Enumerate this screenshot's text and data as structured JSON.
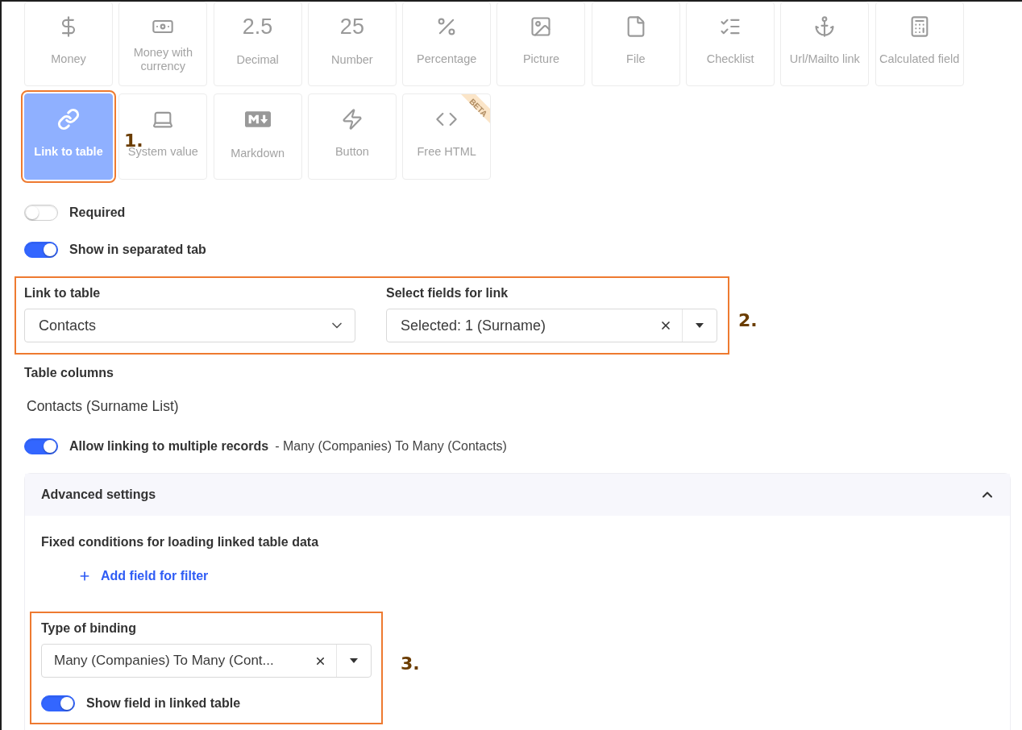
{
  "field_types": [
    {
      "label": "Money",
      "kind": "dollar",
      "selected": false,
      "highlighted": false
    },
    {
      "label": "Money with currency",
      "kind": "cheque",
      "selected": false,
      "highlighted": false
    },
    {
      "label": "Decimal",
      "kind": "glyph",
      "glyph": "2.5",
      "selected": false,
      "highlighted": false
    },
    {
      "label": "Number",
      "kind": "glyph",
      "glyph": "25",
      "selected": false,
      "highlighted": false
    },
    {
      "label": "Percentage",
      "kind": "percent",
      "selected": false,
      "highlighted": false
    },
    {
      "label": "Picture",
      "kind": "image",
      "selected": false,
      "highlighted": false
    },
    {
      "label": "File",
      "kind": "file",
      "selected": false,
      "highlighted": false
    },
    {
      "label": "Checklist",
      "kind": "checklist",
      "selected": false,
      "highlighted": false
    },
    {
      "label": "Url/Mailto link",
      "kind": "anchor",
      "selected": false,
      "highlighted": false
    },
    {
      "label": "Calculated field",
      "kind": "calculator",
      "selected": false,
      "highlighted": false
    },
    {
      "label": "Link to table",
      "kind": "link",
      "selected": true,
      "highlighted": true,
      "annotation": "1."
    },
    {
      "label": "System value",
      "kind": "laptop",
      "selected": false,
      "highlighted": false
    },
    {
      "label": "Markdown",
      "kind": "markdown",
      "selected": false,
      "highlighted": false
    },
    {
      "label": "Button",
      "kind": "bolt",
      "selected": false,
      "highlighted": false
    },
    {
      "label": "Free HTML",
      "kind": "code",
      "selected": false,
      "highlighted": false,
      "badge": "BETA"
    }
  ],
  "toggles": [
    {
      "label": "Required",
      "on": false
    },
    {
      "label": "Show in separated tab",
      "on": true
    }
  ],
  "link_section": {
    "annotation": "2.",
    "fields": [
      {
        "label": "Link to table",
        "value": "Contacts",
        "kind": "chevron"
      },
      {
        "label": "Select fields for link",
        "value": "Selected: 1 (Surname)",
        "kind": "clearable"
      }
    ]
  },
  "table_columns": {
    "label": "Table columns",
    "value": "Contacts (Surname List)"
  },
  "multiple_records": {
    "label": "Allow linking to multiple records",
    "on": true,
    "note": "- Many (Companies) To Many (Contacts)"
  },
  "advanced_settings": {
    "title": "Advanced settings",
    "expanded": true,
    "conditions_label": "Fixed conditions for loading linked table data",
    "add_filter": "Add field for filter",
    "binding": {
      "annotation": "3.",
      "label": "Type of binding",
      "value": "Many (Companies) To Many (Cont...",
      "toggle": {
        "label": "Show field in linked table",
        "on": true
      }
    }
  }
}
